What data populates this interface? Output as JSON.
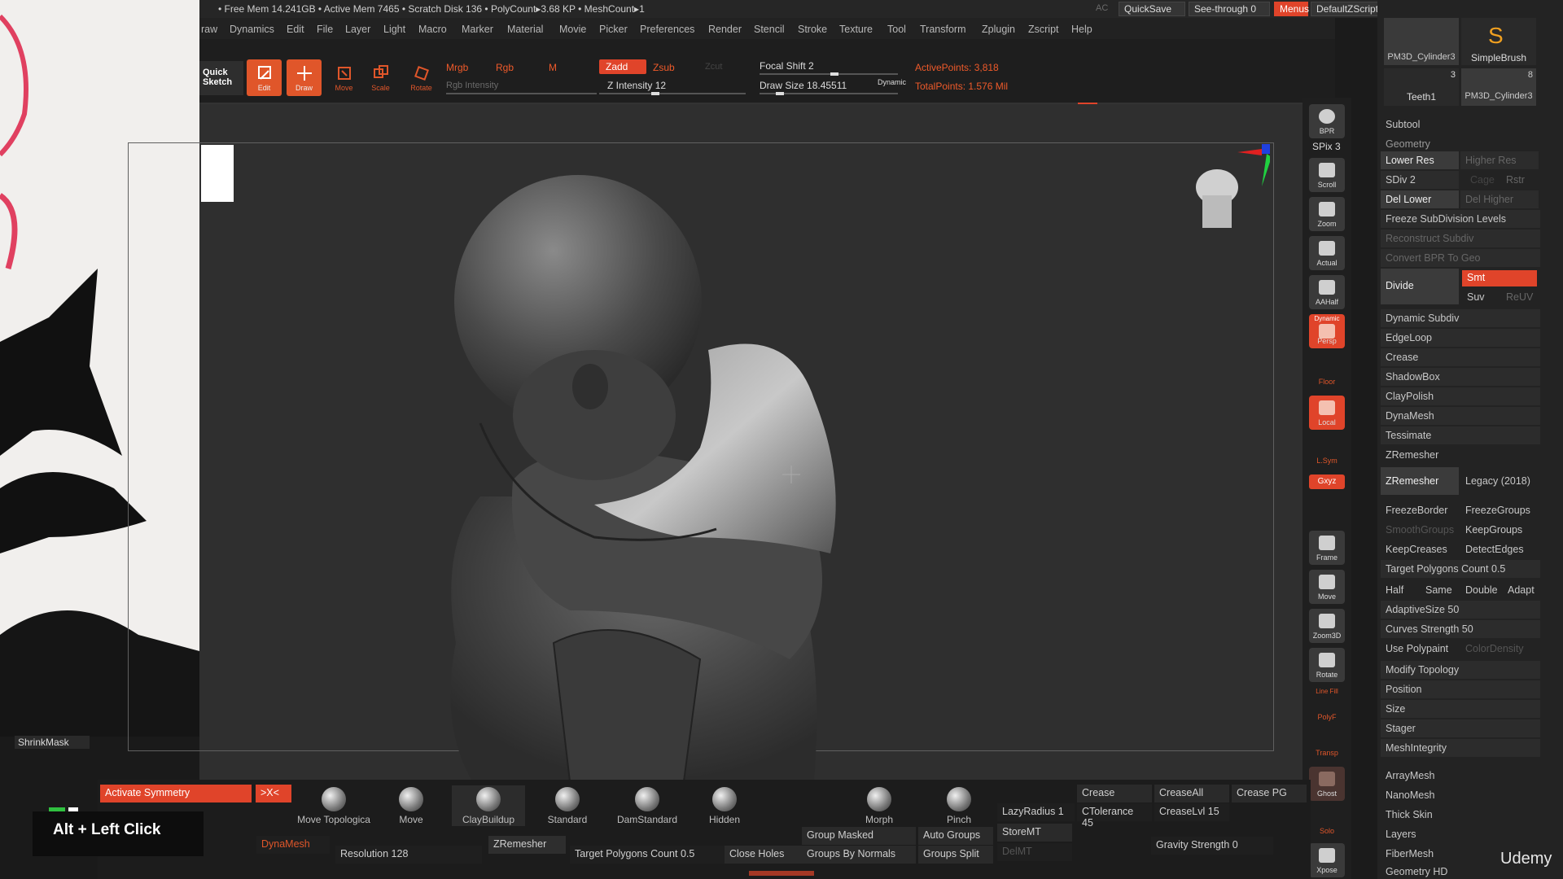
{
  "status": {
    "text": "• Free Mem 14.241GB • Active Mem 7465 • Scratch Disk 136 • PolyCount▸3.68 KP • MeshCount▸1",
    "ac": "AC",
    "quicksave": "QuickSave",
    "see_through": "See-through",
    "see_through_value": "0",
    "menus": "Menus",
    "default_zscript": "DefaultZScript"
  },
  "menubar": [
    "raw",
    "Dynamics",
    "Edit",
    "File",
    "Layer",
    "Light",
    "Macro",
    "Marker",
    "Material",
    "Movie",
    "Picker",
    "Preferences",
    "Render",
    "Stencil",
    "Stroke",
    "Texture",
    "Tool",
    "Transform",
    "Zplugin",
    "Zscript",
    "Help"
  ],
  "toolbar": {
    "quick_sketch": "Quick Sketch",
    "edit": "Edit",
    "draw": "Draw",
    "move": "Move",
    "scale": "Scale",
    "rotate": "Rotate",
    "mrgb": "Mrgb",
    "rgb": "Rgb",
    "m": "M",
    "rgb_intensity": "Rgb Intensity",
    "zadd": "Zadd",
    "zsub": "Zsub",
    "zcut": "Zcut",
    "z_intensity": "Z Intensity 12",
    "focal_shift": "Focal Shift 2",
    "draw_size": "Draw Size 18.45511",
    "dynamic": "Dynamic",
    "active_points": "ActivePoints: 3,818",
    "total_points": "TotalPoints: 1.576 Mil"
  },
  "subtools_top": {
    "item1": "PM3D_Cylinder3",
    "item2": "SimpleBrush",
    "item3": "Teeth1",
    "item3_count": "3",
    "item4": "PM3D_Cylinder3",
    "item4_count": "8"
  },
  "right_icons": [
    "BPR",
    "SPix 3",
    "Scroll",
    "Zoom",
    "Actual",
    "AAHalf",
    "Persp",
    "Floor",
    "Local",
    "L.Sym",
    "Gxyz",
    "Frame",
    "Move",
    "Zoom3D",
    "Rotate",
    "PolyF",
    "Transp",
    "Ghost",
    "Solo",
    "Xpose"
  ],
  "right_icon_extra": {
    "dynamic": "Dynamic",
    "line_fill": "Line Fill"
  },
  "panel": {
    "subtool": "Subtool",
    "geometry": "Geometry",
    "lower_res": "Lower Res",
    "higher_res": "Higher Res",
    "sdiv": "SDiv 2",
    "cage": "Cage",
    "rstr": "Rstr",
    "del_lower": "Del Lower",
    "del_higher": "Del Higher",
    "freeze_subdiv": "Freeze SubDivision Levels",
    "reconstruct": "Reconstruct Subdiv",
    "convert_bpr": "Convert BPR To Geo",
    "divide": "Divide",
    "smt": "Smt",
    "suv": "Suv",
    "reuv": "ReUV",
    "dynamic_subdiv": "Dynamic Subdiv",
    "edgeloop": "EdgeLoop",
    "crease": "Crease",
    "shadowbox": "ShadowBox",
    "claypolish": "ClayPolish",
    "dynamesh": "DynaMesh",
    "tessimate": "Tessimate",
    "zremesher_head": "ZRemesher",
    "zremesher_btn": "ZRemesher",
    "legacy": "Legacy (2018)",
    "freeze_border": "FreezeBorder",
    "freeze_groups": "FreezeGroups",
    "smooth_groups": "SmoothGroups",
    "keep_groups": "KeepGroups",
    "keep_creases": "KeepCreases",
    "detect_edges": "DetectEdges",
    "target_poly": "Target Polygons Count 0.5",
    "half": "Half",
    "same": "Same",
    "double": "Double",
    "adapt": "Adapt",
    "adaptive_size": "AdaptiveSize 50",
    "curves_strength": "Curves Strength 50",
    "use_polypaint": "Use Polypaint",
    "color_density": "ColorDensity",
    "modify_topology": "Modify Topology",
    "position": "Position",
    "size": "Size",
    "stager": "Stager",
    "meshintegrity": "MeshIntegrity",
    "arraymesh": "ArrayMesh",
    "nanomesh": "NanoMesh",
    "thick_skin": "Thick Skin",
    "layers": "Layers",
    "fibermesh": "FiberMesh",
    "geometry_hd": "Geometry HD"
  },
  "bottom": {
    "shrinkmask": "ShrinkMask",
    "activate_symmetry": "Activate Symmetry",
    "x_axis": ">X<",
    "brushes": [
      "Move Topologica",
      "Move",
      "ClayBuildup",
      "Standard",
      "DamStandard",
      "Hidden",
      "Morph",
      "Pinch"
    ],
    "lazy_radius": "LazyRadius 1",
    "crease": "Crease",
    "crease_all": "CreaseAll",
    "crease_pg": "Crease PG",
    "ctolerance": "CTolerance 45",
    "creaselvl": "CreaseLvl 15",
    "dynamesh": "DynaMesh",
    "resolution": "Resolution 128",
    "zremesher": "ZRemesher",
    "target_poly": "Target Polygons Count 0.5",
    "close_holes": "Close Holes",
    "group_masked": "Group Masked",
    "groups_by_normals": "Groups By Normals",
    "auto_groups": "Auto Groups",
    "groups_split": "Groups Split",
    "storemt": "StoreMT",
    "delmt": "DelMT",
    "gravity": "Gravity Strength 0"
  },
  "hint": "Alt + Left Click",
  "watermark": "Udemy",
  "colors": {
    "accent": "#e0562a",
    "panel_bg": "#232323",
    "viewport_bg": "#2f2f2f"
  }
}
